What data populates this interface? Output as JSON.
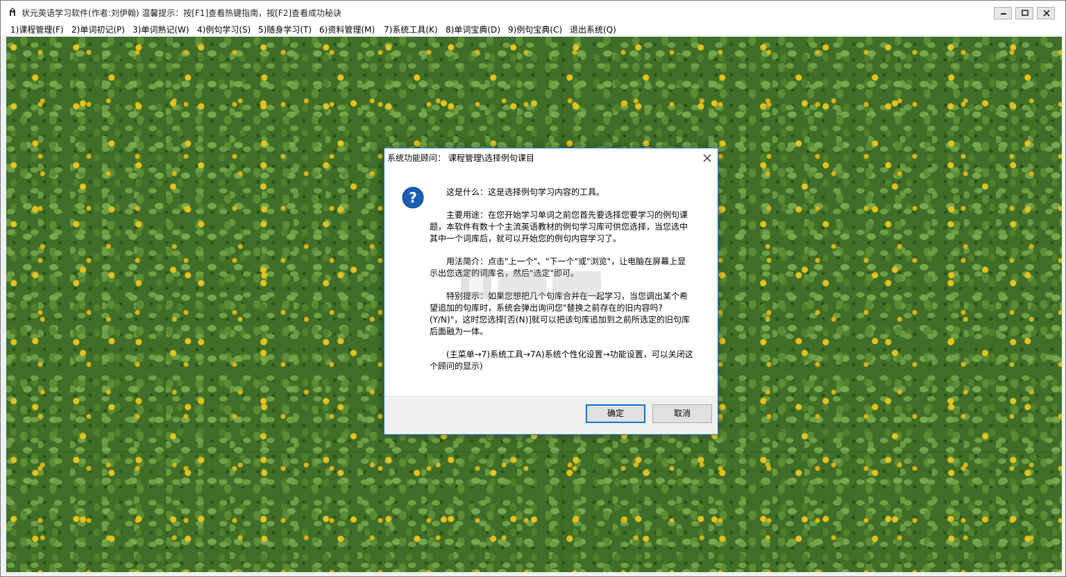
{
  "window": {
    "title": "状元英语学习软件(作者:刘伊翰)  温馨提示：按[F1]查看热键指南，按[F2]查看成功秘诀"
  },
  "menu": {
    "items": [
      "1)课程管理(F)",
      "2)单词初记(P)",
      "3)单词熟记(W)",
      "4)例句学习(S)",
      "5)随身学习(T)",
      "6)资料管理(M)",
      "7)系统工具(K)",
      "8)单词宝典(D)",
      "9)例句宝典(C)",
      "退出系统(Q)"
    ]
  },
  "dialog": {
    "title": "系统功能顾问：   课程管理\\选择例句课目",
    "paragraphs": [
      "这是什么：这是选择例句学习内容的工具。",
      "主要用途：在您开始学习单词之前您首先要选择您要学习的例句课题，本软件有数十个主流英语教材的例句学习库可供您选择，当您选中其中一个词库后，就可以开始您的例句内容学习了。",
      "用法简介：点击\"上一个\"、\"下一个\"或\"浏览\"，让电脑在屏幕上显示出您选定的词库名，然后\"选定\"即可。",
      "特别提示：如果您想把几个句库合并在一起学习，当您调出某个希望追加的句库时，系统会弹出询问您\"替换之前存在的旧内容吗?(Y/N)\"，这时您选择[否(N)]就可以把该句库追加到之前所选定的旧句库后面融为一体。",
      "(主菜单→7)系统工具→7A)系统个性化设置→功能设置，可以关闭这个顾问的显示)"
    ],
    "ok_label": "确定",
    "cancel_label": "取消"
  },
  "icons": {
    "app": "app-icon",
    "question": "question-icon",
    "close": "close-icon"
  },
  "colors": {
    "accent": "#0078d7",
    "question_icon": "#1a5fb4"
  }
}
